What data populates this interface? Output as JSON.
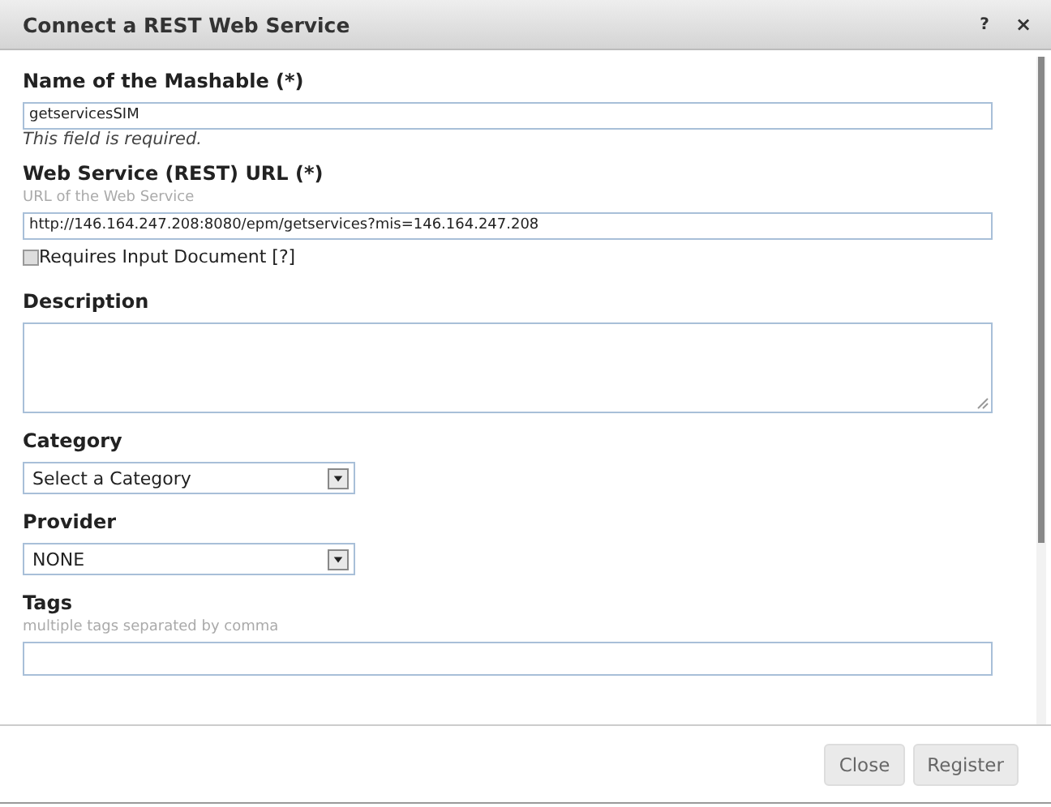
{
  "dialog": {
    "title": "Connect a REST Web Service",
    "help": "?",
    "close": "×"
  },
  "fields": [
    {
      "kind": "text",
      "label": "Name of the Mashable (*)",
      "value": "getservicesSIM",
      "error": "This field is required."
    },
    {
      "kind": "text",
      "label": "Web Service (REST) URL (*)",
      "hint": "URL of the Web Service",
      "value": "http://146.164.247.208:8080/epm/getservices?mis=146.164.247.208"
    },
    {
      "kind": "checkbox",
      "label": "Requires Input Document [?]",
      "checked": false
    },
    {
      "kind": "textarea",
      "label": "Description"
    },
    {
      "kind": "select",
      "label": "Category",
      "value": "Select a Category"
    },
    {
      "kind": "select",
      "label": "Provider",
      "value": "NONE"
    },
    {
      "kind": "text",
      "label": "Tags",
      "hint": "multiple tags separated by comma"
    }
  ],
  "buttons": [
    "Close",
    "Register"
  ]
}
